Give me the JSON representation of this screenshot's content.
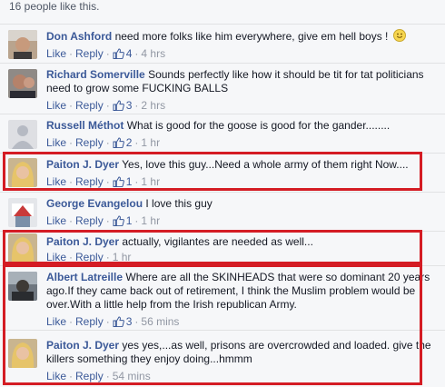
{
  "likes_summary": "16 people like this.",
  "actions": {
    "like": "Like",
    "reply": "Reply"
  },
  "comments": [
    {
      "author": "Don Ashford",
      "text": "need more folks like him everywhere, give em hell boys !",
      "likes": "4",
      "time": "4 hrs"
    },
    {
      "author": "Richard Somerville",
      "text": "Sounds perfectly like how it should be tit for tat politicians need to grow some FUCKING BALLS",
      "likes": "3",
      "time": "2 hrs"
    },
    {
      "author": "Russell Méthot",
      "text": "What is good for the goose is good for the gander........",
      "likes": "2",
      "time": "1 hr"
    },
    {
      "author": "Paiton J. Dyer",
      "text": "Yes, love this guy...Need a whole army of them right Now....",
      "likes": "1",
      "time": "1 hr"
    },
    {
      "author": "George Evangelou",
      "text": "I love this guy",
      "likes": "1",
      "time": "1 hr"
    },
    {
      "author": "Paiton J. Dyer",
      "text": "actually, vigilantes are needed as well...",
      "likes": "",
      "time": "1 hr"
    },
    {
      "author": "Albert Latreille",
      "text": "Where are all the SKINHEADS that were so dominant 20 years ago.If they came back out of retirement, I think the Muslim problem would be over.With a little help from the Irish republican Army.",
      "likes": "3",
      "time": "56 mins"
    },
    {
      "author": "Paiton J. Dyer",
      "text": "yes yes,...as well, prisons are overcrowded and loaded. give the killers something they enjoy doing...hmmm",
      "likes": "",
      "time": "54 mins"
    }
  ],
  "colors": {
    "author_link": "#3b5998",
    "highlight_box": "#d41c24",
    "meta_text": "#9197a3"
  }
}
